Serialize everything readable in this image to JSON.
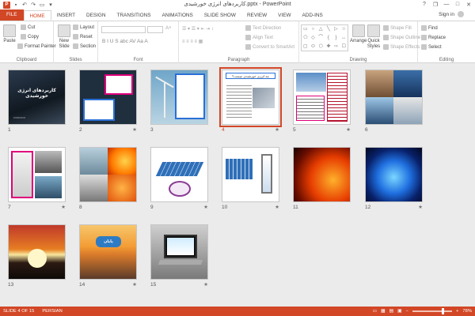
{
  "app": {
    "title": "کاربردهای انرژی خورشیدی.pptx - PowerPoint",
    "logo_letter": "P",
    "accent": "#d24726"
  },
  "quick_access": [
    "save-icon",
    "undo-icon",
    "redo-icon",
    "start-from-beginning-icon",
    "customize-icon"
  ],
  "window_controls": [
    "?",
    "❐",
    "—",
    "□",
    "✕"
  ],
  "tabs": [
    "FILE",
    "HOME",
    "INSERT",
    "DESIGN",
    "TRANSITIONS",
    "ANIMATIONS",
    "SLIDE SHOW",
    "REVIEW",
    "VIEW",
    "ADD-INS"
  ],
  "active_tab": "HOME",
  "sign_in": "Sign in",
  "ribbon": {
    "clipboard": {
      "label": "Clipboard",
      "paste": "Paste",
      "cut": "Cut",
      "copy": "Copy",
      "format_painter": "Format Painter"
    },
    "slides": {
      "label": "Slides",
      "new_slide": "New Slide",
      "layout": "Layout",
      "reset": "Reset",
      "section": "Section"
    },
    "font": {
      "label": "Font",
      "buttons": "B  I  U  S  abc  AV  Aa  A"
    },
    "paragraph": {
      "label": "Paragraph",
      "text_direction": "Text Direction",
      "align_text": "Align Text",
      "convert_smartart": "Convert to SmartArt"
    },
    "drawing": {
      "label": "Drawing",
      "arrange": "Arrange",
      "quick_styles": "Quick Styles",
      "shape_fill": "Shape Fill",
      "shape_outline": "Shape Outline",
      "shape_effects": "Shape Effects"
    },
    "editing": {
      "label": "Editing",
      "find": "Find",
      "replace": "Replace",
      "select": "Select"
    }
  },
  "slides": [
    {
      "number": "1",
      "title": "کاربردهای انرژی خورشیدی",
      "star": false,
      "theme": "dark-sky"
    },
    {
      "number": "2",
      "star": true,
      "theme": "text-panels"
    },
    {
      "number": "3",
      "star": false,
      "theme": "wind-turbine"
    },
    {
      "number": "4",
      "title": "چه انرژی خورشیدی چیست؟",
      "star": true,
      "theme": "selected-text",
      "selected": true
    },
    {
      "number": "5",
      "star": true,
      "theme": "plane-text"
    },
    {
      "number": "6",
      "star": false,
      "theme": "solar-collage"
    },
    {
      "number": "7",
      "star": true,
      "theme": "vehicles"
    },
    {
      "number": "8",
      "star": false,
      "theme": "car-sun"
    },
    {
      "number": "9",
      "star": true,
      "theme": "panel-diagram"
    },
    {
      "number": "10",
      "star": true,
      "theme": "panel-tank"
    },
    {
      "number": "11",
      "star": false,
      "theme": "sun-red"
    },
    {
      "number": "12",
      "star": true,
      "theme": "sun-blue"
    },
    {
      "number": "13",
      "star": false,
      "theme": "sunset"
    },
    {
      "number": "14",
      "title": "پایان",
      "star": true,
      "theme": "sunset-sea"
    },
    {
      "number": "15",
      "star": true,
      "theme": "laptop"
    }
  ],
  "status": {
    "slide_of": "SLIDE 4 OF 15",
    "language": "PERSIAN",
    "zoom": "78%",
    "zoom_fraction": 0.78
  }
}
